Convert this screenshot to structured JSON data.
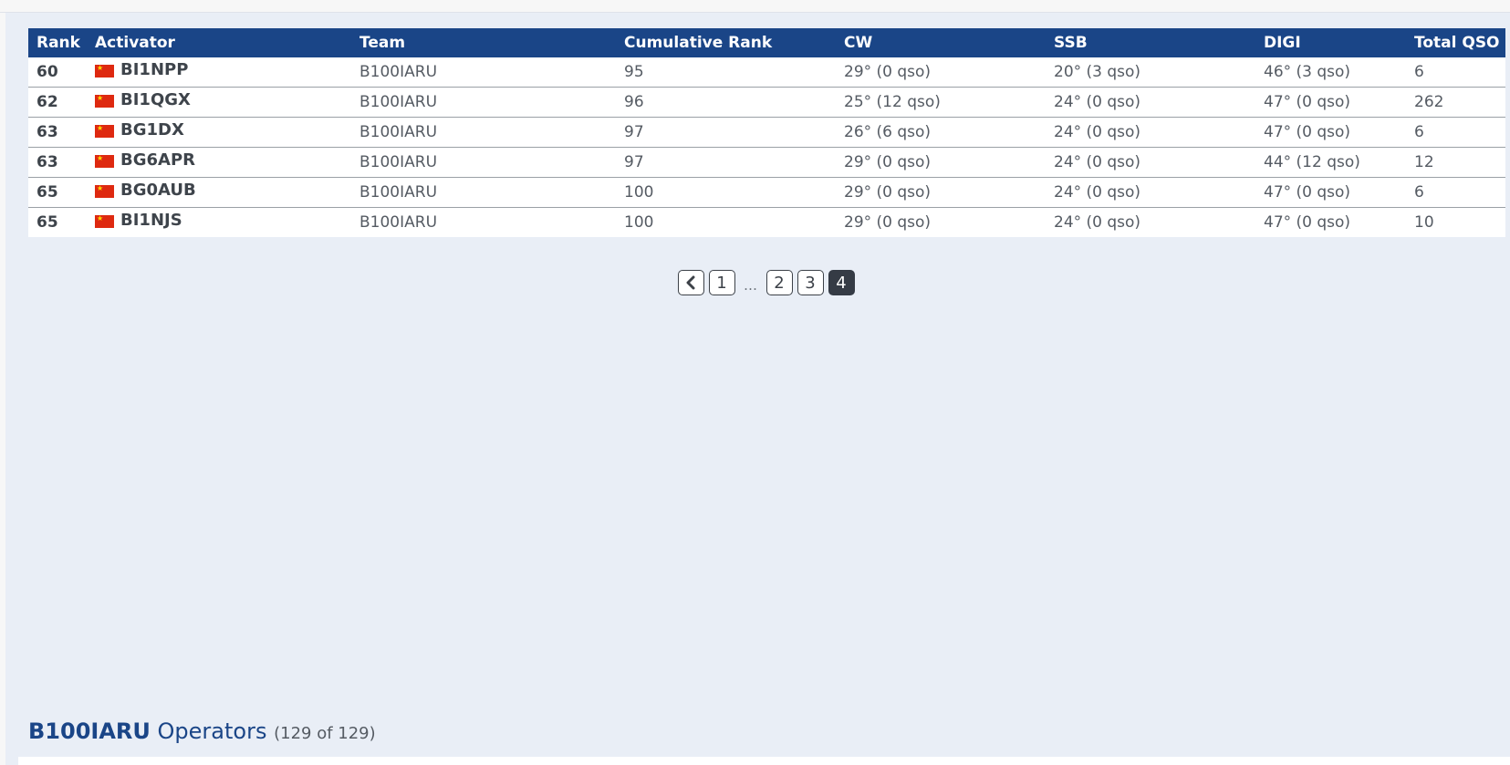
{
  "table": {
    "headers": [
      "Rank",
      "Activator",
      "Team",
      "Cumulative Rank",
      "CW",
      "SSB",
      "DIGI",
      "Total QSO"
    ],
    "rows": [
      {
        "rank": "60",
        "flag": "china-flag-icon",
        "activator": "BI1NPP",
        "team": "B100IARU",
        "cumulative_rank": "95",
        "cw": "29° (0 qso)",
        "ssb": "20° (3 qso)",
        "digi": "46° (3 qso)",
        "total_qso": "6"
      },
      {
        "rank": "62",
        "flag": "china-flag-icon",
        "activator": "BI1QGX",
        "team": "B100IARU",
        "cumulative_rank": "96",
        "cw": "25° (12 qso)",
        "ssb": "24° (0 qso)",
        "digi": "47° (0 qso)",
        "total_qso": "262"
      },
      {
        "rank": "63",
        "flag": "china-flag-icon",
        "activator": "BG1DX",
        "team": "B100IARU",
        "cumulative_rank": "97",
        "cw": "26° (6 qso)",
        "ssb": "24° (0 qso)",
        "digi": "47° (0 qso)",
        "total_qso": "6"
      },
      {
        "rank": "63",
        "flag": "china-flag-icon",
        "activator": "BG6APR",
        "team": "B100IARU",
        "cumulative_rank": "97",
        "cw": "29° (0 qso)",
        "ssb": "24° (0 qso)",
        "digi": "44° (12 qso)",
        "total_qso": "12"
      },
      {
        "rank": "65",
        "flag": "china-flag-icon",
        "activator": "BG0AUB",
        "team": "B100IARU",
        "cumulative_rank": "100",
        "cw": "29° (0 qso)",
        "ssb": "24° (0 qso)",
        "digi": "47° (0 qso)",
        "total_qso": "6"
      },
      {
        "rank": "65",
        "flag": "china-flag-icon",
        "activator": "BI1NJS",
        "team": "B100IARU",
        "cumulative_rank": "100",
        "cw": "29° (0 qso)",
        "ssb": "24° (0 qso)",
        "digi": "47° (0 qso)",
        "total_qso": "10"
      }
    ]
  },
  "pagination": {
    "prev_icon": "chevron-left-icon",
    "pages": [
      "1",
      "…",
      "2",
      "3",
      "4"
    ],
    "current": "4"
  },
  "operators": {
    "team": "B100IARU",
    "label": "Operators",
    "count": "(129 of 129)"
  },
  "colors": {
    "header_bg": "#1a4587",
    "page_bg": "#e9eef6",
    "active_page": "#353b45"
  }
}
